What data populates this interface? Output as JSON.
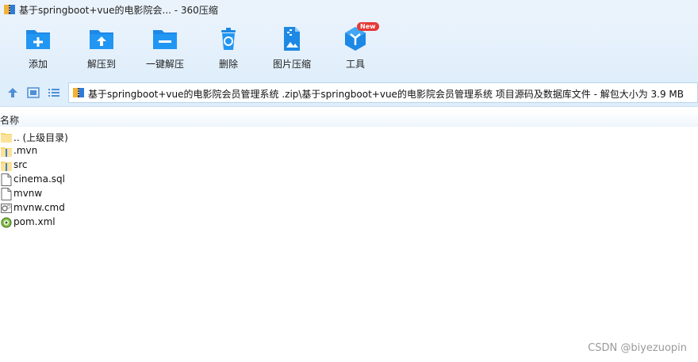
{
  "window": {
    "title": "基于springboot+vue的电影院会... - 360压缩"
  },
  "toolbar": {
    "items": [
      {
        "label": "添加",
        "icon": "add-icon"
      },
      {
        "label": "解压到",
        "icon": "extract-to-icon"
      },
      {
        "label": "一键解压",
        "icon": "one-click-extract-icon"
      },
      {
        "label": "删除",
        "icon": "delete-icon"
      },
      {
        "label": "图片压缩",
        "icon": "image-compress-icon"
      },
      {
        "label": "工具",
        "icon": "tools-icon",
        "badge": "New"
      }
    ],
    "colors": {
      "icon_blue": "#1e88e5",
      "badge_red": "#e53935"
    }
  },
  "navigation": {
    "path": "基于springboot+vue的电影院会员管理系统 .zip\\基于springboot+vue的电影院会员管理系统 项目源码及数据库文件 - 解包大小为 3.9 MB"
  },
  "file_list": {
    "column_name": "名称",
    "files": [
      {
        "name": ".. (上级目录)",
        "icon": "folder-up-icon"
      },
      {
        "name": ".mvn",
        "icon": "folder-icon"
      },
      {
        "name": "src",
        "icon": "folder-icon"
      },
      {
        "name": "cinema.sql",
        "icon": "file-icon"
      },
      {
        "name": "mvnw",
        "icon": "file-icon"
      },
      {
        "name": "mvnw.cmd",
        "icon": "cmd-file-icon"
      },
      {
        "name": "pom.xml",
        "icon": "xml-file-icon"
      }
    ]
  },
  "watermark": "CSDN @biyezuopin"
}
